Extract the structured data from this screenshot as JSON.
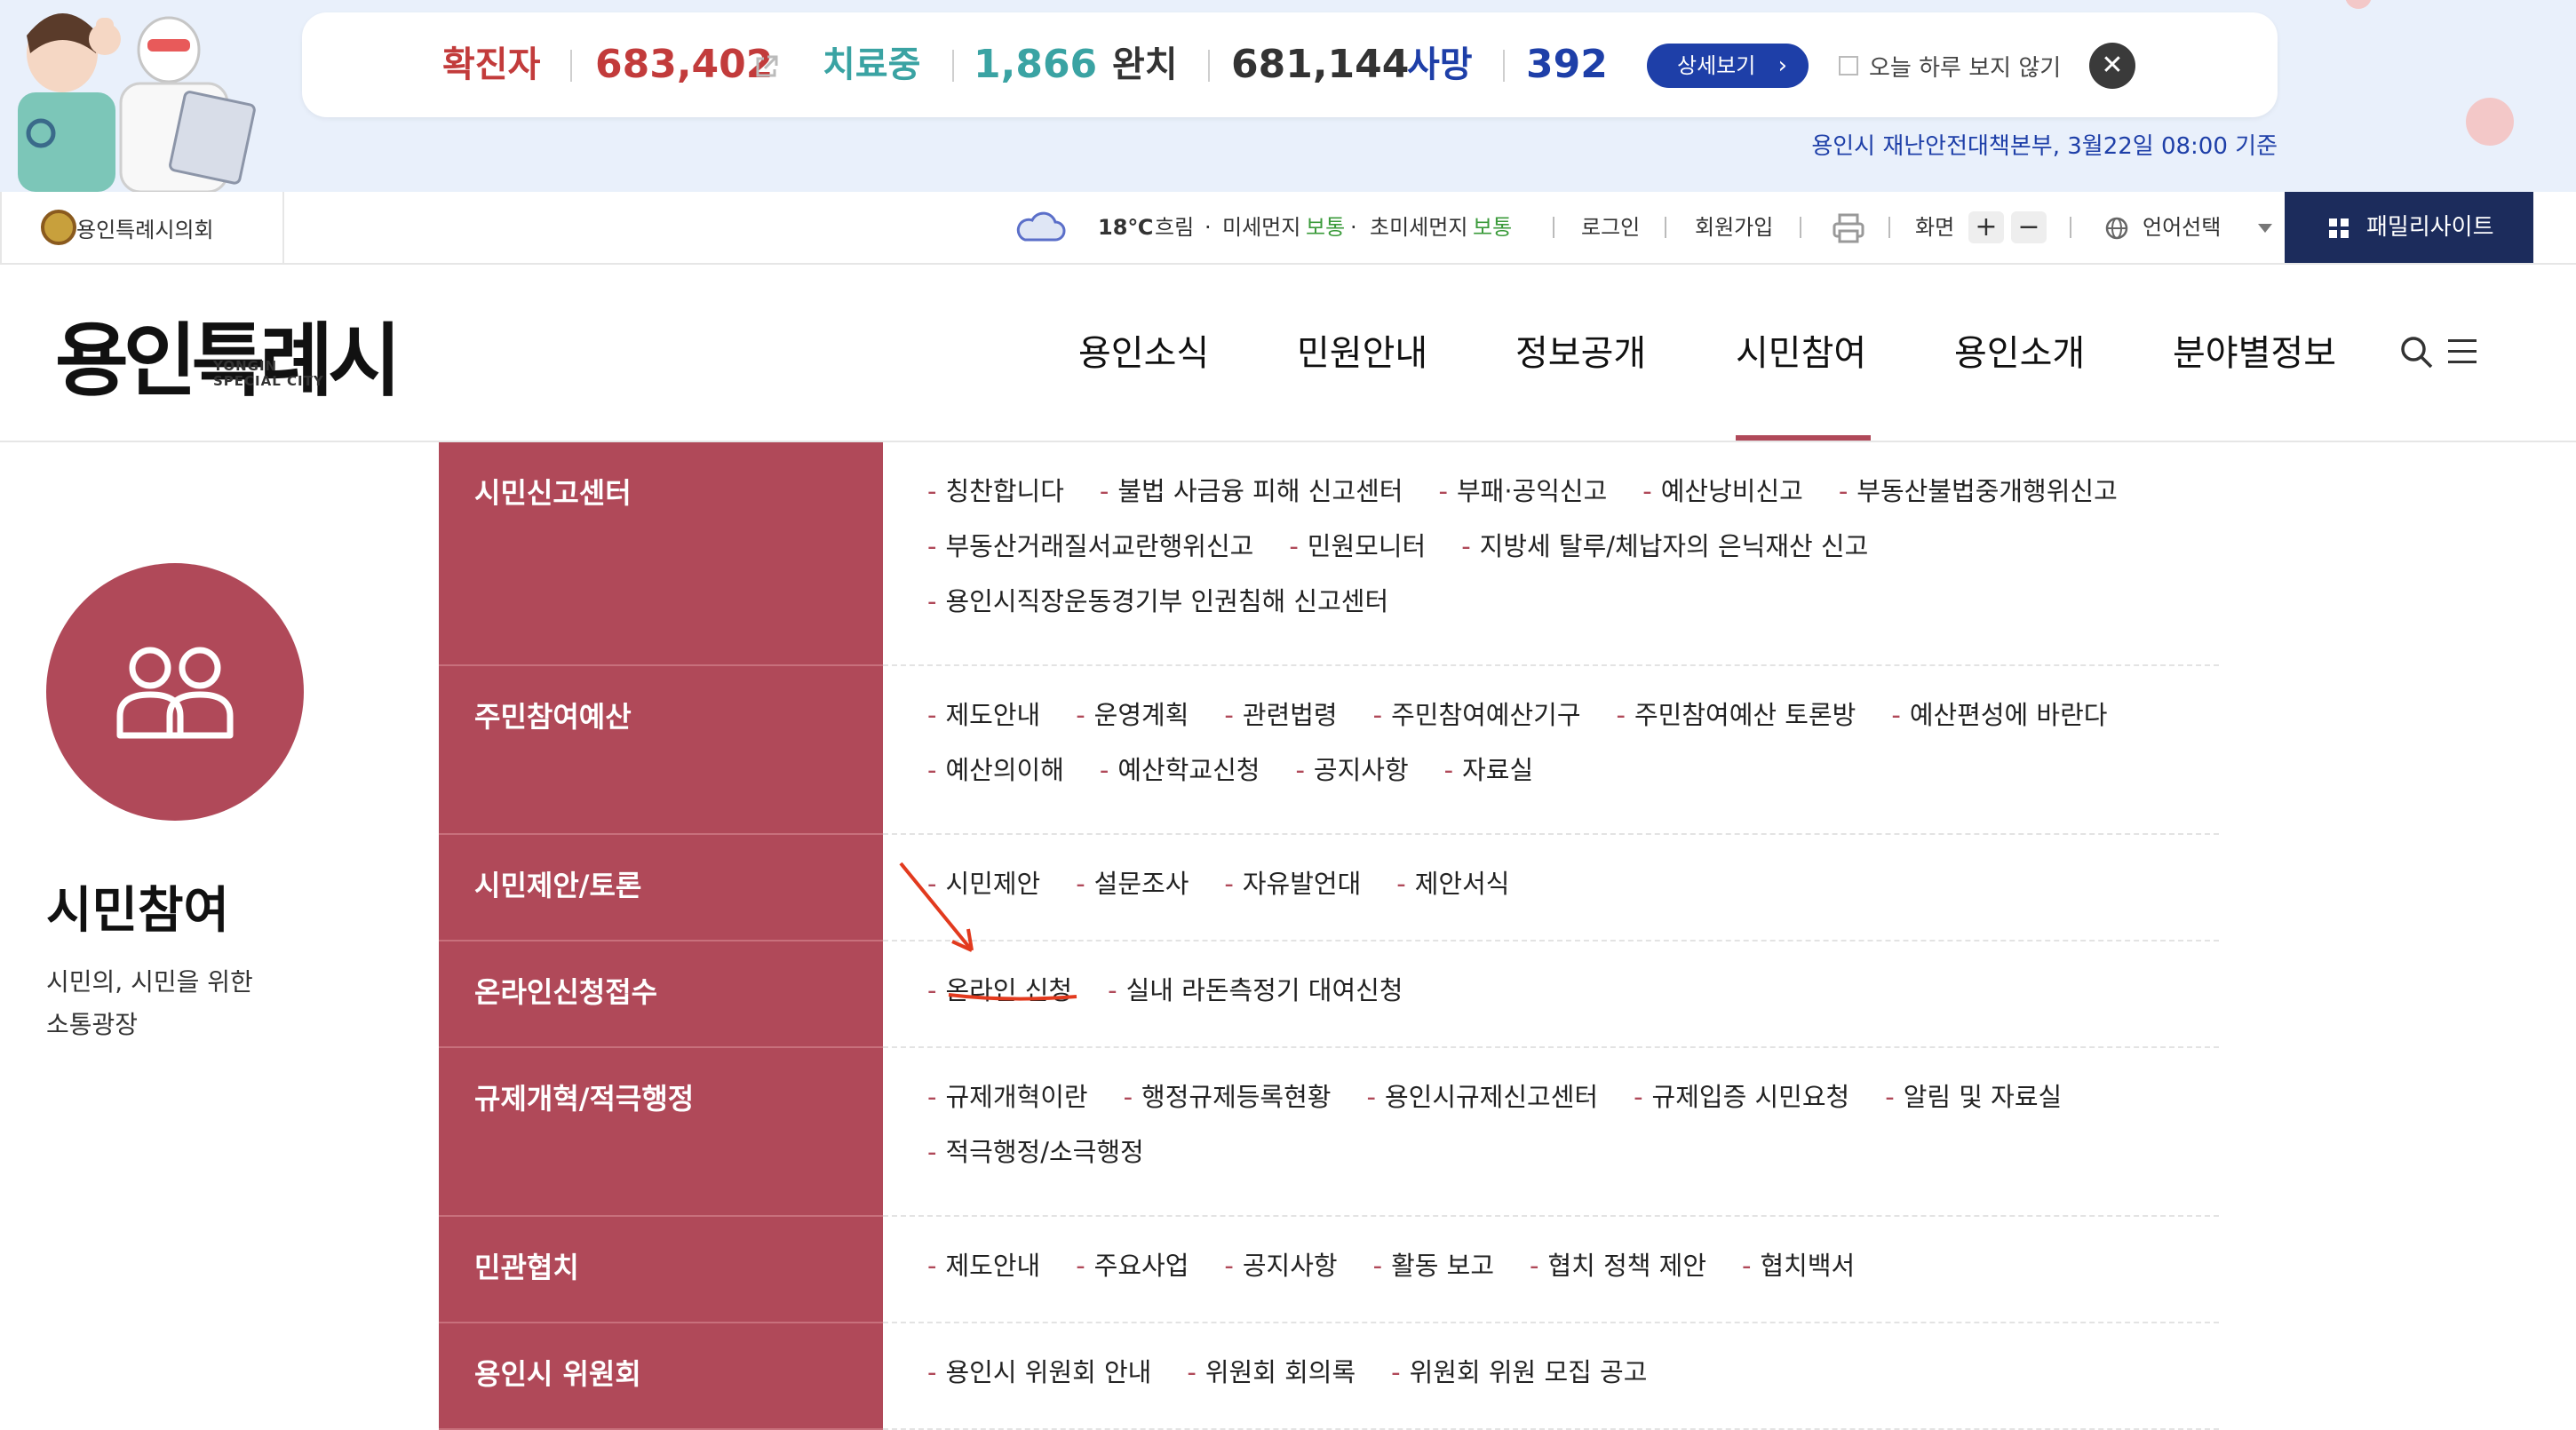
{
  "banner": {
    "confirmed_label": "확진자",
    "confirmed_value": "683,402",
    "treating_label": "치료중",
    "treating_value": "1,866",
    "recovered_label": "완치",
    "recovered_value": "681,144",
    "death_label": "사망",
    "death_value": "392",
    "detail_button": "상세보기",
    "hide_today": "오늘 하루 보지 않기",
    "source": "용인시 재난안전대책본부, 3월22일 08:00 기준",
    "colors": {
      "confirmed": "#c23b3b",
      "treating": "#3aa3a3",
      "recovered": "#333333",
      "death": "#1e3fa8"
    }
  },
  "utility": {
    "council": "용인특례시의회",
    "temperature": "18℃",
    "weather": "흐림",
    "fine_dust_label": "미세먼지",
    "fine_dust_value": "보통",
    "ultrafine_dust_label": "초미세먼지",
    "ultrafine_dust_value": "보통",
    "login": "로그인",
    "signup": "회원가입",
    "screen": "화면",
    "zoom_in": "+",
    "zoom_out": "−",
    "language": "언어선택",
    "family_site": "패밀리사이트"
  },
  "header": {
    "logo_text": "용인특례시",
    "logo_en_line1": "YONGIN",
    "logo_en_line2": "SPECIAL CITY",
    "nav": [
      "용인소식",
      "민원안내",
      "정보공개",
      "시민참여",
      "용인소개",
      "분야별정보"
    ],
    "active_nav": "시민참여"
  },
  "section": {
    "title": "시민참여",
    "desc_line1": "시민의, 시민을 위한",
    "desc_line2": "소통광장"
  },
  "submenu": [
    {
      "category": "시민신고센터",
      "lines": [
        [
          "칭찬합니다",
          "불법 사금융 피해 신고센터",
          "부패·공익신고",
          "예산낭비신고",
          "부동산불법중개행위신고"
        ],
        [
          "부동산거래질서교란행위신고",
          "민원모니터",
          "지방세 탈루/체납자의 은닉재산 신고"
        ],
        [
          "용인시직장운동경기부 인권침해 신고센터"
        ]
      ]
    },
    {
      "category": "주민참여예산",
      "lines": [
        [
          "제도안내",
          "운영계획",
          "관련법령",
          "주민참여예산기구",
          "주민참여예산 토론방",
          "예산편성에 바란다"
        ],
        [
          "예산의이해",
          "예산학교신청",
          "공지사항",
          "자료실"
        ]
      ]
    },
    {
      "category": "시민제안/토론",
      "lines": [
        [
          "시민제안",
          "설문조사",
          "자유발언대",
          "제안서식"
        ]
      ]
    },
    {
      "category": "온라인신청접수",
      "lines": [
        [
          "온라인 신청",
          "실내 라돈측정기 대여신청"
        ]
      ]
    },
    {
      "category": "규제개혁/적극행정",
      "lines": [
        [
          "규제개혁이란",
          "행정규제등록현황",
          "용인시규제신고센터",
          "규제입증 시민요청",
          "알림 및 자료실"
        ],
        [
          "적극행정/소극행정"
        ]
      ]
    },
    {
      "category": "민관협치",
      "lines": [
        [
          "제도안내",
          "주요사업",
          "공지사항",
          "활동 보고",
          "협치 정책 제안",
          "협치백서"
        ]
      ]
    },
    {
      "category": "용인시 위원회",
      "lines": [
        [
          "용인시 위원회 안내",
          "위원회 회의록",
          "위원회 위원 모집 공고"
        ]
      ]
    }
  ],
  "link_dash": "-",
  "accent_color": "#b04959"
}
